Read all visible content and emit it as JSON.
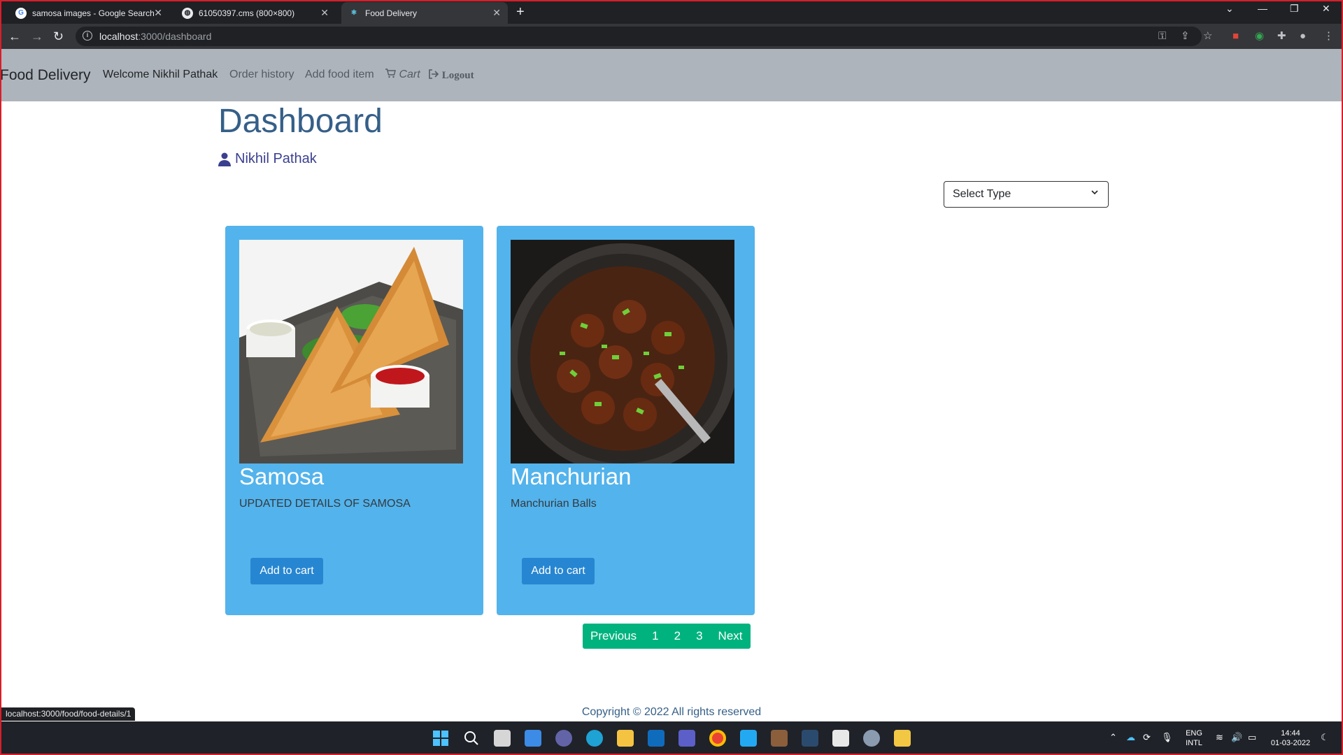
{
  "browser": {
    "tabs": [
      {
        "title": "samosa images - Google Search"
      },
      {
        "title": "61050397.cms (800×800)"
      },
      {
        "title": "Food Delivery"
      }
    ],
    "new_tab": "+",
    "url_host": "localhost",
    "url_path": ":3000/dashboard",
    "status_url": "localhost:3000/food/food-details/1"
  },
  "navbar": {
    "brand": "Food Delivery",
    "welcome": "Welcome Nikhil Pathak",
    "order_history": "Order history",
    "add_food": "Add food item",
    "cart": "Cart",
    "logout": "Logout"
  },
  "dashboard": {
    "title": "Dashboard",
    "user_name": "Nikhil Pathak",
    "select_type": "Select Type"
  },
  "cards": [
    {
      "name": "Samosa",
      "description": "UPDATED DETAILS OF SAMOSA",
      "button": "Add to cart",
      "image_icon": "samosa-photo"
    },
    {
      "name": "Manchurian",
      "description": "Manchurian Balls",
      "button": "Add to cart",
      "image_icon": "manchurian-photo"
    }
  ],
  "pagination": {
    "previous": "Previous",
    "pages": [
      "1",
      "2",
      "3"
    ],
    "next": "Next"
  },
  "footer": "Copyright © 2022 All rights reserved",
  "taskbar": {
    "lang_top": "ENG",
    "lang_bottom": "INTL",
    "time": "14:44",
    "date": "01-03-2022"
  },
  "colors": {
    "navbar": "#aeb4bb",
    "card": "#53b3ec",
    "button": "#2686d1",
    "pagination": "#00b37e",
    "title": "#355f88"
  }
}
